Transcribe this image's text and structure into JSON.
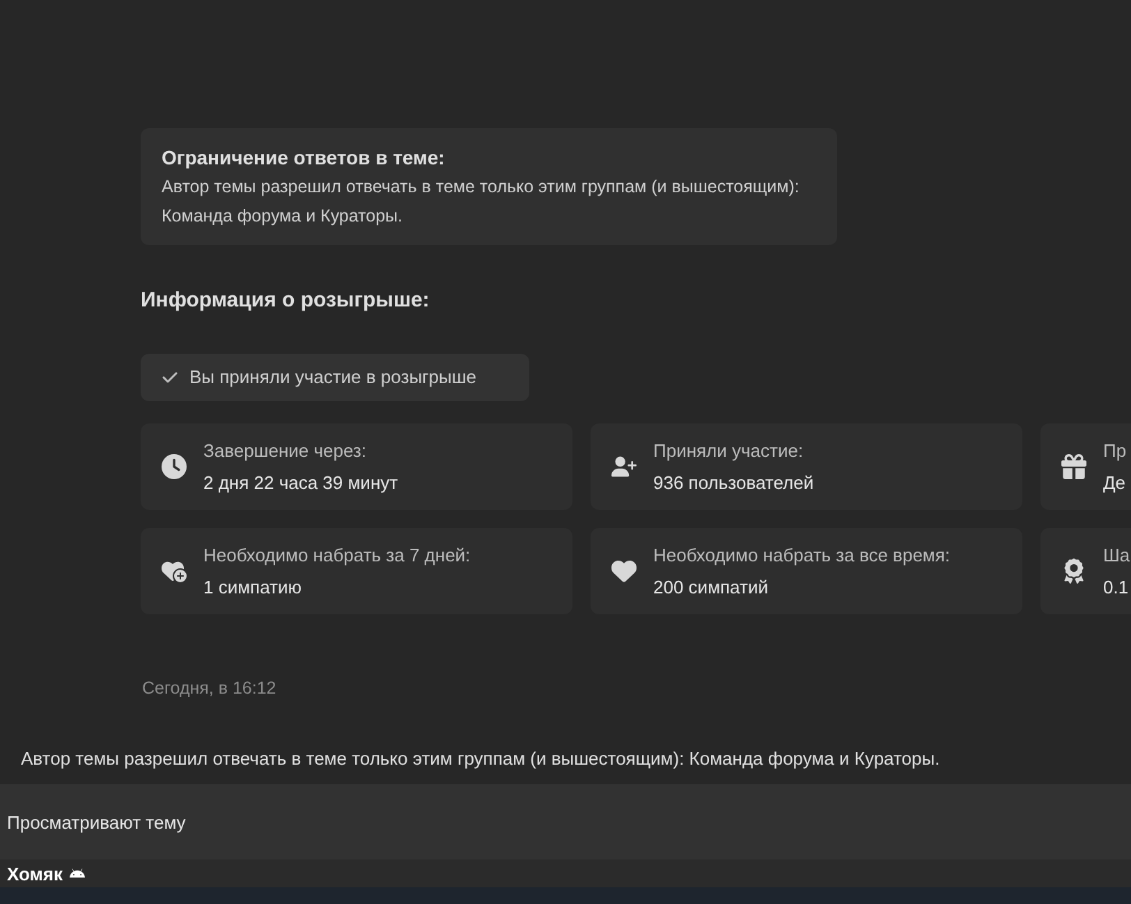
{
  "restriction": {
    "title": "Ограничение ответов в теме:",
    "text": "Автор темы разрешил отвечать в теме только этим группам (и вышестоящим): Команда форума и Кураторы."
  },
  "giveaway": {
    "heading": "Информация о розыгрыше:",
    "participation": {
      "label": "Вы приняли участие в розыгрыше",
      "checked": true
    },
    "stats": [
      {
        "label": "Завершение через:",
        "value": "2 дня 22 часа 39 минут"
      },
      {
        "label": "Приняли участие:",
        "value": "936 пользователей"
      },
      {
        "label": "Пр",
        "value": "Де"
      },
      {
        "label": "Необходимо набрать за 7 дней:",
        "value": "1 симпатию"
      },
      {
        "label": "Необходимо набрать за все время:",
        "value": "200 симпатий"
      },
      {
        "label": "Ша",
        "value": "0.1"
      }
    ]
  },
  "post_date": "Сегодня, в 16:12",
  "notice": "Автор темы разрешил отвечать в теме только этим группам (и вышестоящим): Команда форума и Кураторы.",
  "viewers": {
    "title": "Просматривают тему",
    "users": [
      "Хомяк"
    ]
  }
}
